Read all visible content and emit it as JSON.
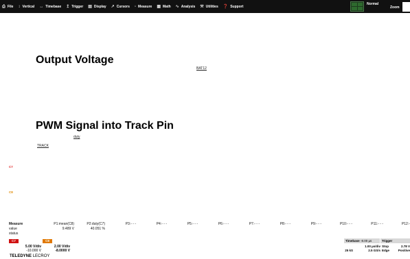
{
  "menu": {
    "items": [
      {
        "icon": "file-icon",
        "glyph": "⎙",
        "label": "File"
      },
      {
        "icon": "vertical-icon",
        "glyph": "↕",
        "label": "Vertical"
      },
      {
        "icon": "timebase-icon",
        "glyph": "↔",
        "label": "Timebase"
      },
      {
        "icon": "trigger-icon",
        "glyph": "↥",
        "label": "Trigger"
      },
      {
        "icon": "display-icon",
        "glyph": "▤",
        "label": "Display"
      },
      {
        "icon": "cursors-icon",
        "glyph": "↗",
        "label": "Cursors"
      },
      {
        "icon": "measure-icon",
        "glyph": "▫",
        "label": "Measure"
      },
      {
        "icon": "math-icon",
        "glyph": "▦",
        "label": "Math"
      },
      {
        "icon": "analysis-icon",
        "glyph": "∿",
        "label": "Analysis"
      },
      {
        "icon": "utilities-icon",
        "glyph": "⚒",
        "label": "Utilities"
      },
      {
        "icon": "support-icon",
        "glyph": "❓",
        "label": "Support"
      }
    ],
    "trigger_mode": "Normal",
    "zoom_label": "Zoom"
  },
  "annotations": {
    "output_heading": "Output Voltage",
    "bat_label": "BAT12",
    "pwm_heading": "PWM Signal into Track Pin",
    "duty_label": "duty",
    "track_label": "TRACK",
    "c7_marker": "C7",
    "c8_marker": "C8"
  },
  "measure": {
    "label": "Measure",
    "value_label": "value",
    "status_label": "status",
    "params": [
      {
        "name": "P1:mean(C8)",
        "value": "9.489 V"
      },
      {
        "name": "P2:duty(C7)",
        "value": "40.051 %"
      },
      {
        "name": "P3:- - -",
        "value": ""
      },
      {
        "name": "P4:- - -",
        "value": ""
      },
      {
        "name": "P5:- - -",
        "value": ""
      },
      {
        "name": "P6:- - -",
        "value": ""
      },
      {
        "name": "P7:- - -",
        "value": ""
      },
      {
        "name": "P8:- - -",
        "value": ""
      },
      {
        "name": "P9:- - -",
        "value": ""
      },
      {
        "name": "P10:- - -",
        "value": ""
      },
      {
        "name": "P11:- - -",
        "value": ""
      },
      {
        "name": "P12:- - -",
        "value": ""
      }
    ]
  },
  "channels": {
    "c7": {
      "badge": "C7",
      "vdiv": "5.00 V/div",
      "offset": "-10.000 V",
      "color": "#d01010"
    },
    "c8": {
      "badge": "C8",
      "vdiv": "2.00 V/div",
      "offset": "-8.0000 V",
      "color": "#e07800"
    }
  },
  "brand": {
    "bold": "TELEDYNE",
    "light": "LECROY"
  },
  "timebase": {
    "label": "Timebase",
    "delay": "-8.00 µs",
    "rate": "1.00 µs/div",
    "samples": "25 kS",
    "sample_rate": "2.5 GS/s"
  },
  "trigger": {
    "label": "Trigger",
    "mode": "Stop",
    "level": "2.78 V",
    "type": "Edge",
    "slope": "Positive"
  }
}
